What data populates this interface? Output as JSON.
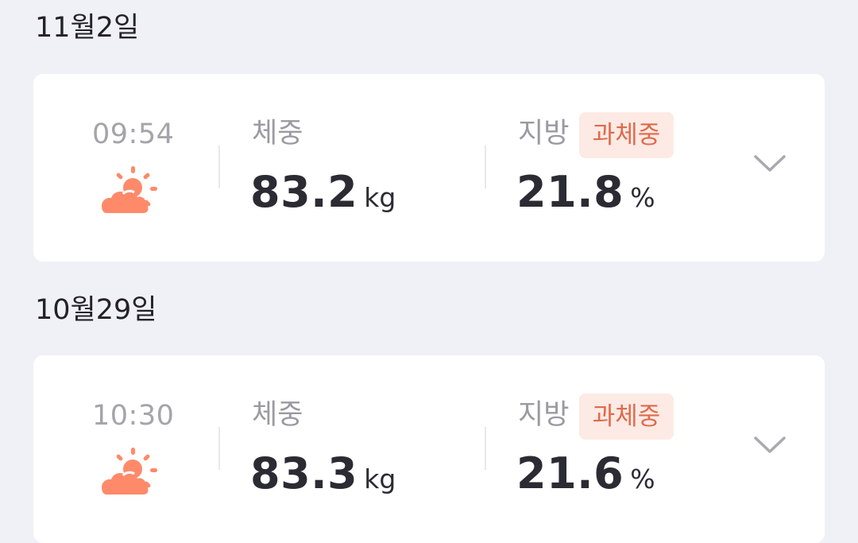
{
  "colors": {
    "background": "#f0f1f6",
    "card": "#ffffff",
    "badge_bg": "#fdeae4",
    "badge_text": "#e06a4c",
    "weather_icon": "#ff8a6a"
  },
  "sections": [
    {
      "date": "11월2일",
      "entry": {
        "time": "09:54",
        "weather_icon": "sun-cloud-icon",
        "weight_label": "체중",
        "weight_value": "83.2",
        "weight_unit": "kg",
        "fat_label": "지방",
        "fat_badge": "과체중",
        "fat_value": "21.8",
        "fat_unit": "%"
      }
    },
    {
      "date": "10월29일",
      "entry": {
        "time": "10:30",
        "weather_icon": "sun-cloud-icon",
        "weight_label": "체중",
        "weight_value": "83.3",
        "weight_unit": "kg",
        "fat_label": "지방",
        "fat_badge": "과체중",
        "fat_value": "21.6",
        "fat_unit": "%"
      }
    }
  ]
}
